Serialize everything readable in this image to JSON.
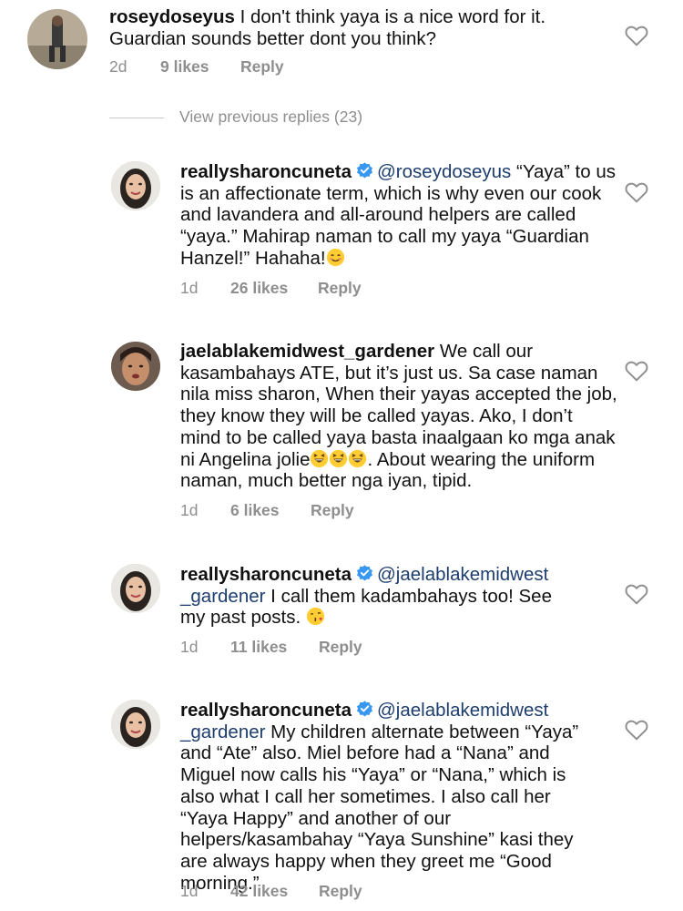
{
  "colors": {
    "text": "#111111",
    "meta": "#8e8e8e",
    "mention": "#1d3d6e",
    "verified": "#3897f0"
  },
  "comments": [
    {
      "username": "roseydoseyus",
      "text": "I don't think yaya is a nice word for it. Guardian sounds better dont you think?",
      "time": "2d",
      "likes": "9 likes",
      "reply": "Reply"
    },
    {
      "username": "reallysharoncuneta",
      "mention": "@roseydoseyus",
      "text": "“Yaya” to us is an affectionate term, which is why even our cook and lavandera and all-around helpers are called “yaya.” Mahirap naman to call my yaya “Guardian Hanzel!” Hahaha!",
      "time": "1d",
      "likes": "26 likes",
      "reply": "Reply"
    },
    {
      "username": "jaelablakemidwest_gardener",
      "text_a": "We call our kasambahays ATE, but it’s just us. Sa case naman nila miss sharon, When their yayas accepted the job, they know they will be called yayas. Ako, I don’t mind to be called yaya basta inaalgaan ko mga anak ni Angelina jolie",
      "text_b": ". About wearing the uniform naman, much better nga iyan, tipid.",
      "time": "1d",
      "likes": "6 likes",
      "reply": "Reply"
    },
    {
      "username": "reallysharoncuneta",
      "mention": "@jaelablakemidwest _gardener",
      "text": "I call them kadambahays too! See my past posts.",
      "time": "1d",
      "likes": "11 likes",
      "reply": "Reply"
    },
    {
      "username": "reallysharoncuneta",
      "mention": "@jaelablakemidwest _gardener",
      "text": "My children alternate between “Yaya” and “Ate” also. Miel before had a “Nana” and Miguel now calls his “Yaya” or “Nana,” which is also what I call her sometimes. I also call her “Yaya Happy” and another of our helpers/kasambahay “Yaya Sunshine” kasi they are always happy when they greet me “Good morning.”",
      "time": "1d",
      "likes": "42 likes",
      "reply": "Reply"
    }
  ],
  "view_replies": "View previous replies (23)"
}
